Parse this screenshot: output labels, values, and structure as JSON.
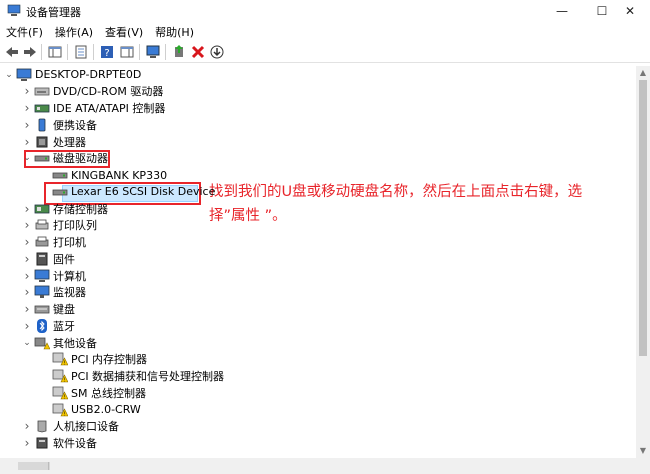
{
  "window": {
    "title": "设备管理器",
    "minimize": "—",
    "maximize": "☐",
    "close": "✕"
  },
  "menu": [
    "文件(F)",
    "操作(A)",
    "查看(V)",
    "帮助(H)"
  ],
  "tree": {
    "root": "DESKTOP-DRPTE0D",
    "items": [
      {
        "label": "DVD/CD-ROM 驱动器",
        "icon": "dvd-drive-icon",
        "expanded": false
      },
      {
        "label": "IDE ATA/ATAPI 控制器",
        "icon": "ide-controller-icon",
        "expanded": false
      },
      {
        "label": "便携设备",
        "icon": "portable-device-icon",
        "expanded": false
      },
      {
        "label": "处理器",
        "icon": "processor-icon",
        "expanded": false
      },
      {
        "label": "磁盘驱动器",
        "icon": "disk-drive-icon",
        "expanded": true,
        "children": [
          "KINGBANK KP330",
          "Lexar E6 SCSI Disk Device"
        ]
      },
      {
        "label": "存储控制器",
        "icon": "storage-controller-icon",
        "expanded": false
      },
      {
        "label": "打印队列",
        "icon": "print-queue-icon",
        "expanded": false
      },
      {
        "label": "打印机",
        "icon": "printer-icon",
        "expanded": false
      },
      {
        "label": "固件",
        "icon": "firmware-icon",
        "expanded": false
      },
      {
        "label": "计算机",
        "icon": "computer-icon",
        "expanded": false
      },
      {
        "label": "监视器",
        "icon": "monitor-icon",
        "expanded": false
      },
      {
        "label": "键盘",
        "icon": "keyboard-icon",
        "expanded": false
      },
      {
        "label": "蓝牙",
        "icon": "bluetooth-icon",
        "expanded": false
      },
      {
        "label": "其他设备",
        "icon": "other-devices-icon",
        "expanded": true,
        "children": [
          "PCI 内存控制器",
          "PCI 数据捕获和信号处理控制器",
          "SM 总线控制器",
          "USB2.0-CRW"
        ]
      },
      {
        "label": "人机接口设备",
        "icon": "hid-icon",
        "expanded": false
      },
      {
        "label": "软件设备",
        "icon": "software-device-icon",
        "expanded": false
      }
    ]
  },
  "annotation": "找到我们的U盘或移动硬盘名称，然后在上面点击右键，选择”属性 ”。",
  "colors": {
    "highlight": "#e8252b",
    "selection": "#cce8ff"
  }
}
